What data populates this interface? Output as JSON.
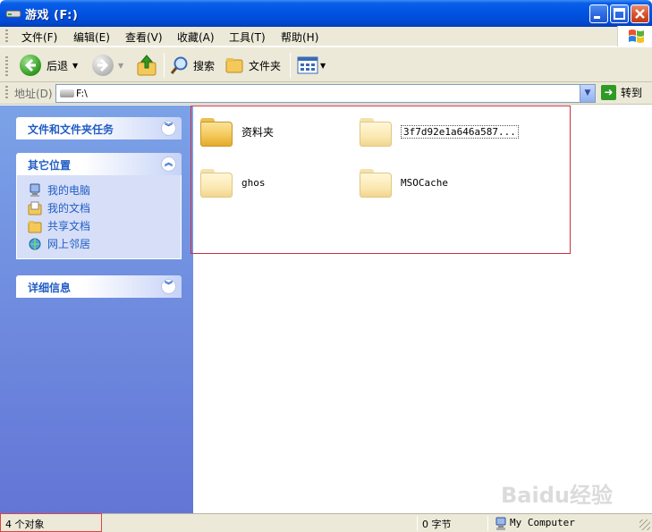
{
  "window": {
    "title": "游戏  (F:)"
  },
  "menu": {
    "items": [
      "文件(F)",
      "编辑(E)",
      "查看(V)",
      "收藏(A)",
      "工具(T)",
      "帮助(H)"
    ]
  },
  "toolbar": {
    "back": "后退",
    "search": "搜索",
    "folders": "文件夹"
  },
  "address": {
    "label": "地址(D)",
    "value": "F:\\",
    "go": "转到"
  },
  "sidebar": {
    "tasks_title": "文件和文件夹任务",
    "places_title": "其它位置",
    "places": [
      {
        "label": "我的电脑",
        "icon": "my-computer-icon"
      },
      {
        "label": "我的文档",
        "icon": "my-documents-icon"
      },
      {
        "label": "共享文档",
        "icon": "shared-documents-icon"
      },
      {
        "label": "网上邻居",
        "icon": "network-places-icon"
      }
    ],
    "details_title": "详细信息"
  },
  "folders": [
    {
      "name": "资料夹"
    },
    {
      "name": "3f7d92e1a646a587..."
    },
    {
      "name": "ghos"
    },
    {
      "name": "MSOCache"
    }
  ],
  "status": {
    "objects": "4 个对象",
    "size": "0 字节",
    "location": "My Computer"
  },
  "watermark": {
    "text": "Baidu经验"
  },
  "colors": {
    "titlebar": "#0053e1",
    "taskpane_top": "#7ba2e7",
    "taskpane_bottom": "#6375d6",
    "link": "#215dc6",
    "highlight": "#c9303e"
  }
}
